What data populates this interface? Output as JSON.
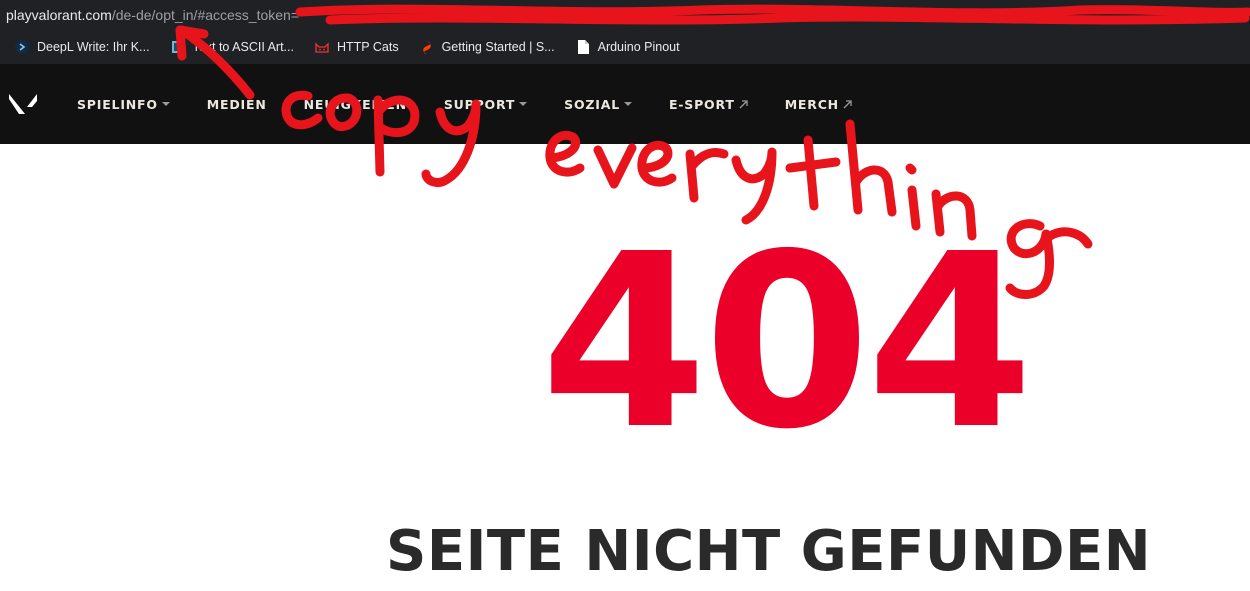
{
  "address_bar": {
    "host": "playvalorant.com",
    "path": "/de-de/opt_in/#access_token="
  },
  "bookmarks": [
    {
      "label": "DeepL Write: Ihr K...",
      "icon": "deepl-icon"
    },
    {
      "label": "Text to ASCII Art...",
      "icon": "ascii-icon"
    },
    {
      "label": "HTTP Cats",
      "icon": "cat-icon"
    },
    {
      "label": "Getting Started | S...",
      "icon": "svelte-icon"
    },
    {
      "label": "Arduino Pinout",
      "icon": "document-icon"
    }
  ],
  "nav": {
    "items": [
      {
        "label": "SPIELINFO",
        "indicator": "dropdown"
      },
      {
        "label": "MEDIEN",
        "indicator": "none"
      },
      {
        "label": "NEUIGKEITEN",
        "indicator": "none"
      },
      {
        "label": "SUPPORT",
        "indicator": "dropdown"
      },
      {
        "label": "SOZIAL",
        "indicator": "dropdown"
      },
      {
        "label": "E-SPORT",
        "indicator": "external"
      },
      {
        "label": "MERCH",
        "indicator": "external"
      }
    ]
  },
  "error": {
    "code": "404",
    "message": "SEITE NICHT GEFUNDEN"
  },
  "annotation": {
    "text": "copy everything",
    "color": "#e8141c"
  },
  "colors": {
    "brand_red": "#ea0029",
    "nav_bg": "#111111",
    "browser_bg": "#202124"
  }
}
